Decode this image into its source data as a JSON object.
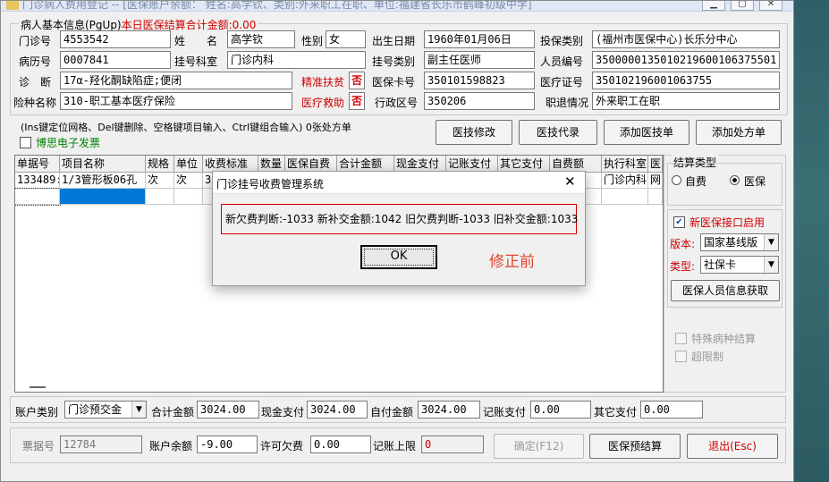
{
  "window": {
    "title": "门诊病人费用登记 -- [医保账户余额： 姓名:高学钦、类别:外来职工在职、单位:福建省长乐市鹤峰初级中学]"
  },
  "patient_group": {
    "title": "病人基本信息(PgUp)",
    "settle_note": "本日医保结算合计金额:0.00"
  },
  "fields": {
    "clinic_no_label": "门诊号",
    "clinic_no": "4553542",
    "name_label": "姓　　名",
    "name": "高学钦",
    "gender_label": "性别",
    "gender": "女",
    "birth_label": "出生日期",
    "birth": "1960年01月06日",
    "insured_type_label": "投保类别",
    "insured_type": "(福州市医保中心)长乐分中心",
    "record_no_label": "病历号",
    "record_no": "0007841",
    "reg_dept_label": "挂号科室",
    "reg_dept": "门诊内科",
    "reg_type_label": "挂号类别",
    "reg_type": "副主任医师",
    "person_no_label": "人员编号",
    "person_no": "3500000135010219600106375501",
    "diag_label": "诊　断",
    "diag": "17α-羟化酮缺陷症;便闭",
    "poverty_label": "精准扶贫",
    "poverty_flag": "否",
    "card_no_label": "医保卡号",
    "card_no": "350101598823",
    "med_cert_label": "医疗证号",
    "med_cert": "350102196001063755",
    "ins_type_label": "险种名称",
    "ins_type": "310-职工基本医疗保险",
    "aid_label": "医疗救助",
    "aid_flag": "否",
    "region_label": "行政区号",
    "region": "350206",
    "retire_label": "职退情况",
    "retire": "外来职工在职"
  },
  "hint": {
    "text": "(Ins键定位网格、Del键删除、空格键项目输入、Ctrl键组合输入)",
    "count": "0张处方单",
    "einvoice_label": "博思电子发票"
  },
  "buttons": {
    "modify": "医技修改",
    "proxy": "医技代录",
    "add_tech": "添加医技单",
    "add_rx": "添加处方单",
    "confirm": "确定(F12)",
    "pre_settle": "医保预结算",
    "exit": "退出(Esc)",
    "fetch_info": "医保人员信息获取"
  },
  "grid": {
    "columns": [
      "单据号",
      "项目名称",
      "规格",
      "单位",
      "收费标准",
      "数量",
      "医保自费",
      "合计金额",
      "现金支付",
      "记账支付",
      "其它支付",
      "自费额",
      "执行科室",
      "医"
    ],
    "row": [
      "133489:",
      "1/3管形板06孔",
      "次",
      "次",
      "3",
      "",
      "",
      "",
      "",
      "",
      "",
      "",
      "门诊内科",
      "网"
    ]
  },
  "settle_panel": {
    "title": "结算类型",
    "self_pay": "自费",
    "insurance": "医保",
    "new_iface": "新医保接口启用",
    "version_label": "版本:",
    "version": "国家基线版",
    "type_label": "类型:",
    "type": "社保卡",
    "special": "特殊病种结算",
    "over_limit": "超限制"
  },
  "totals": {
    "account_type_label": "账户类别",
    "account_type": "门诊预交金",
    "total_label": "合计金额",
    "total": "3024.00",
    "cash_label": "现金支付",
    "cash": "3024.00",
    "self_label": "自付金额",
    "self": "3024.00",
    "ledger_label": "记账支付",
    "ledger": "0.00",
    "other_label": "其它支付",
    "other": "0.00"
  },
  "footer": {
    "ticket_label": "票据号",
    "ticket": "12784",
    "balance_label": "账户余额",
    "balance": "-9.00",
    "credit_label": "许可欠费",
    "credit": "0.00",
    "limit_label": "记账上限",
    "limit": "0"
  },
  "dialog": {
    "title": "门诊挂号收费管理系统",
    "message": "新欠费判断:-1033 新补交金额:1042 旧欠费判断-1033 旧补交金额:1033",
    "ok": "OK",
    "note": "修正前"
  },
  "colors": {
    "accent_red": "#d00000",
    "note_orange": "#e0452c",
    "selection_blue": "#0078d7"
  }
}
